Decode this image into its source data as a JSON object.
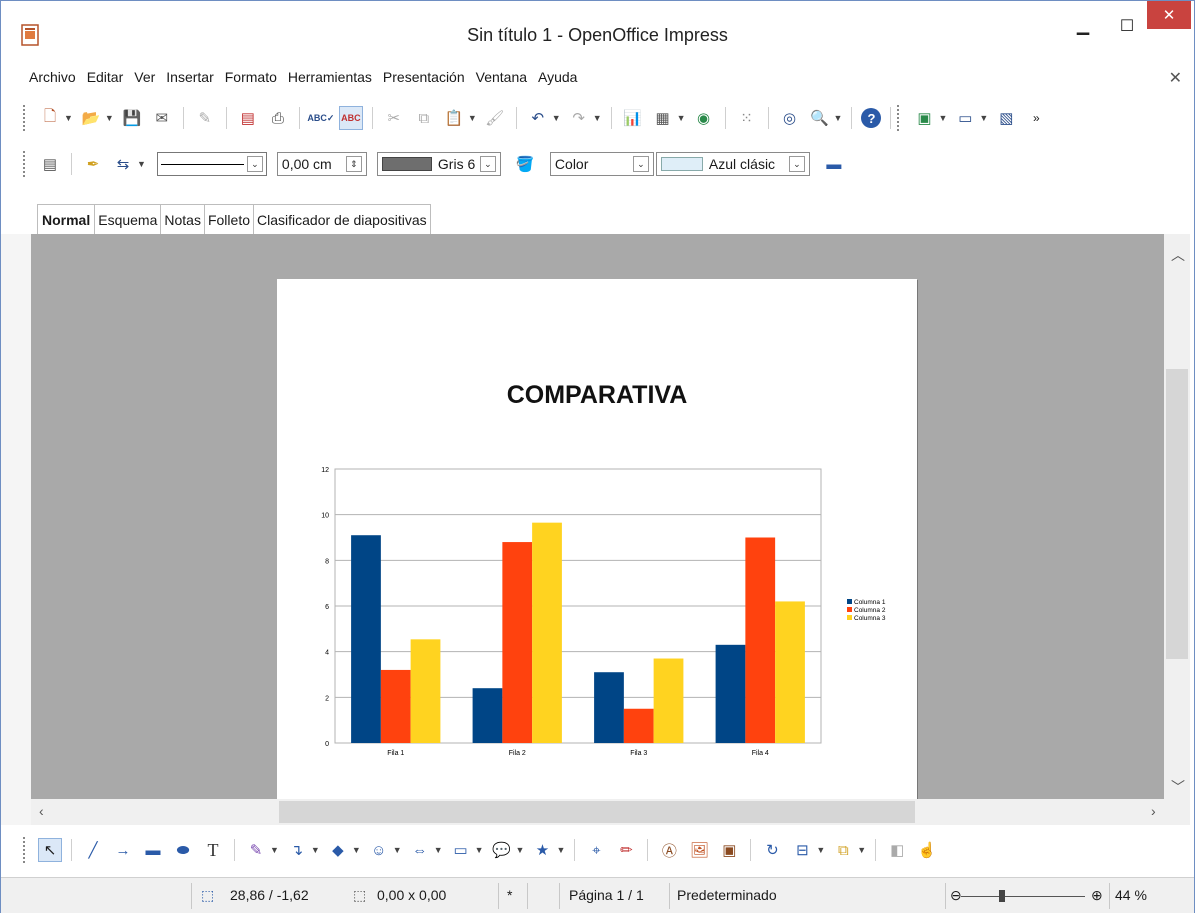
{
  "window": {
    "title": "Sin título 1 - OpenOffice Impress"
  },
  "menubar": {
    "items": [
      "Archivo",
      "Editar",
      "Ver",
      "Insertar",
      "Formato",
      "Herramientas",
      "Presentación",
      "Ventana",
      "Ayuda"
    ]
  },
  "format_toolbar": {
    "line_width": "0,00 cm",
    "line_color": "Gris 6",
    "area_style": "Color",
    "area_color": "Azul clásic"
  },
  "view_tabs": [
    "Normal",
    "Esquema",
    "Notas",
    "Folleto",
    "Clasificador de diapositivas"
  ],
  "slide": {
    "title": "COMPARATIVA"
  },
  "chart_data": {
    "type": "bar",
    "title": "",
    "categories": [
      "Fila 1",
      "Fila 2",
      "Fila 3",
      "Fila 4"
    ],
    "series": [
      {
        "name": "Columna 1",
        "values": [
          9.1,
          2.4,
          3.1,
          4.3
        ],
        "color": "#004586"
      },
      {
        "name": "Columna 2",
        "values": [
          3.2,
          8.8,
          1.5,
          9
        ],
        "color": "#ff420e"
      },
      {
        "name": "Columna 3",
        "values": [
          4.54,
          9.65,
          3.7,
          6.2
        ],
        "color": "#ffd320"
      }
    ],
    "ylim": [
      0,
      12
    ],
    "yticks": [
      "0",
      "2",
      "4",
      "6",
      "8",
      "10",
      "12"
    ],
    "grid": true,
    "legend": "right"
  },
  "statusbar": {
    "position": "28,86 / -1,62",
    "size": "0,00 x 0,00",
    "modified": "*",
    "page": "Página 1 / 1",
    "master": "Predeterminado",
    "zoom": "44 %"
  },
  "colors": {
    "close_button": "#c9433f",
    "workspace": "#a9a9a9"
  }
}
